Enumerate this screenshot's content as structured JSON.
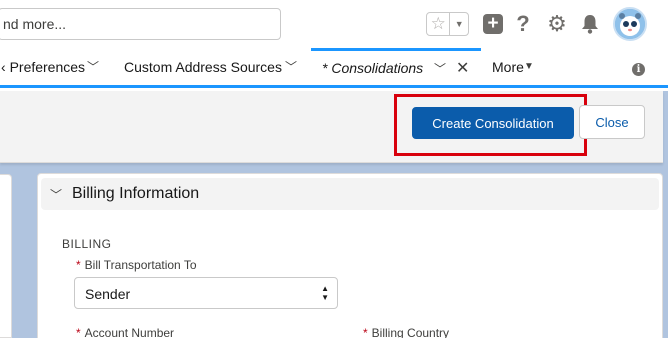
{
  "header": {
    "search_text": "nd more...",
    "icons": [
      "star-icon",
      "dropdown-icon",
      "add-icon",
      "help-icon",
      "gear-icon",
      "bell-icon",
      "avatar"
    ]
  },
  "tabs": [
    {
      "label": "Preferences",
      "prefix": "‹",
      "active": false
    },
    {
      "label": "Custom Address Sources",
      "active": false
    },
    {
      "label": "* Consolidations",
      "active": true
    },
    {
      "label": "More",
      "active": false
    }
  ],
  "actions": {
    "create_label": "Create Consolidation",
    "close_label": "Close",
    "accent_color": "#0b5cab",
    "highlight_color": "#d8000c"
  },
  "section": {
    "title": "Billing Information",
    "group_label": "BILLING",
    "fields": {
      "bill_to_label": "Bill Transportation To",
      "bill_to_value": "Sender",
      "account_number_label": "Account Number",
      "billing_country_label": "Billing Country"
    }
  }
}
